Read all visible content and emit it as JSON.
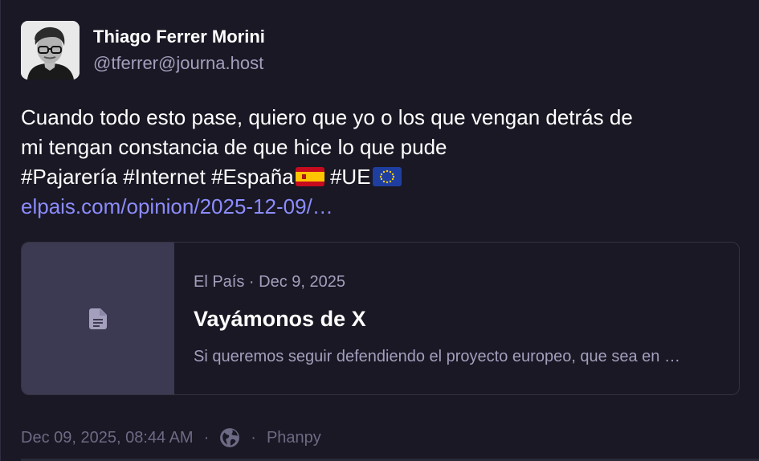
{
  "author": {
    "display_name": "Thiago Ferrer Morini",
    "handle": "@tferrer@journa.host",
    "avatar_icon": "user-avatar"
  },
  "post": {
    "line1": "Cuando todo esto pase, quiero que yo o los que vengan detrás de",
    "line2": "mi tengan constancia de que hice lo que pude",
    "hashtags": [
      "#Pajarería",
      "#Internet",
      "#España",
      "#UE"
    ],
    "link_text": "elpais.com/opinion/2025-12-09/…"
  },
  "card": {
    "meta": "El País · Dec 9, 2025",
    "title": "Vayámonos de X",
    "description": "Si queremos seguir defendiendo el proyecto europeo, que sea en …",
    "thumb_icon": "document-icon"
  },
  "footer": {
    "timestamp": "Dec 09, 2025, 08:44 AM",
    "separator": "·",
    "visibility_icon": "globe-icon",
    "client": "Phanpy"
  },
  "colors": {
    "background": "#191824",
    "link": "#8c8cff",
    "muted": "#a39fbd",
    "thumb": "#3c3a52"
  }
}
